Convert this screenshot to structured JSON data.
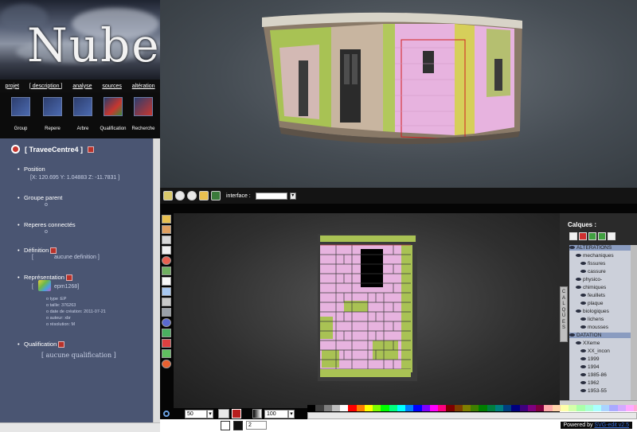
{
  "logo": {
    "text": "Nubes"
  },
  "menu": {
    "items": [
      "projet",
      "[ description ]",
      "analyse",
      "sources",
      "altération"
    ]
  },
  "tools": {
    "items": [
      "Group",
      "Repere",
      "Arbre",
      "Qualification",
      "Recherche"
    ]
  },
  "info": {
    "title": "[ TraveeCentre4 ]",
    "position_label": "Position",
    "position_value": "[X: 120.695 Y: 1.04883 Z: -11.7831 ]",
    "groupe_parent_label": "Groupe parent",
    "groupe_parent_value": "o",
    "reperes_label": "Reperes connectés",
    "reperes_value": "o",
    "definition_label": "Définition",
    "definition_value": "aucune definition ]",
    "definition_open": "[",
    "representation_label": "Représentation",
    "representation_bracket": "[",
    "representation_file": "epm1268]",
    "rep_details": [
      "type :EP",
      "taille: 376263",
      "date de création: 2011-07-21",
      "auteur: xbr",
      "résolution: M"
    ],
    "qualification_label": "Qualification",
    "qualification_value": "[ aucune qualification ]"
  },
  "toolbar2": {
    "interface_label": "interface :"
  },
  "layers": {
    "header": "Calques :",
    "tab_letters": [
      "C",
      "A",
      "L",
      "Q",
      "U",
      "E",
      "S"
    ],
    "items": [
      {
        "label": "ALTERATIONS",
        "level": 0,
        "selected": true
      },
      {
        "label": "mechaniques",
        "level": 1
      },
      {
        "label": "fissures",
        "level": 2
      },
      {
        "label": "cassure",
        "level": 2
      },
      {
        "label": "physico-",
        "level": 1
      },
      {
        "label": "chimiques",
        "level": 1
      },
      {
        "label": "feuillets",
        "level": 2
      },
      {
        "label": "plaque",
        "level": 2
      },
      {
        "label": "biologiques",
        "level": 1
      },
      {
        "label": "lichens",
        "level": 2
      },
      {
        "label": "mousses",
        "level": 2
      },
      {
        "label": "DATATION",
        "level": 0,
        "selected": true
      },
      {
        "label": "XXeme",
        "level": 1
      },
      {
        "label": "XX_incon",
        "level": 2
      },
      {
        "label": "1999",
        "level": 2
      },
      {
        "label": "1994",
        "level": 2
      },
      {
        "label": "1985-86",
        "level": 2
      },
      {
        "label": "1962",
        "level": 2
      },
      {
        "label": "1953-55",
        "level": 2
      }
    ]
  },
  "bottombar": {
    "zoom_value": "50",
    "opacity_value": "100",
    "stroke_value": "2"
  },
  "footer": {
    "powered_by": "Powered by",
    "link": "SVG-edit v2.5"
  },
  "colors": {
    "accent": "#4a5572",
    "pink": "#e7b3df",
    "green": "#a9c254"
  },
  "palette": [
    "#000000",
    "#3f3f3f",
    "#7f7f7f",
    "#bfbfbf",
    "#ffffff",
    "#ff0000",
    "#ff7f00",
    "#ffff00",
    "#7fff00",
    "#00ff00",
    "#00ff7f",
    "#00ffff",
    "#007fff",
    "#0000ff",
    "#7f00ff",
    "#ff00ff",
    "#ff007f",
    "#7f0000",
    "#7f3f00",
    "#7f7f00",
    "#3f7f00",
    "#007f00",
    "#007f3f",
    "#007f7f",
    "#003f7f",
    "#00007f",
    "#3f007f",
    "#7f007f",
    "#7f003f",
    "#ffaaaa",
    "#ffd4aa",
    "#ffffaa",
    "#d4ffaa",
    "#aaffaa",
    "#aaffd4",
    "#aaffff",
    "#aad4ff",
    "#aaaaff",
    "#d4aaff",
    "#ffaaff",
    "#ffaad4"
  ]
}
